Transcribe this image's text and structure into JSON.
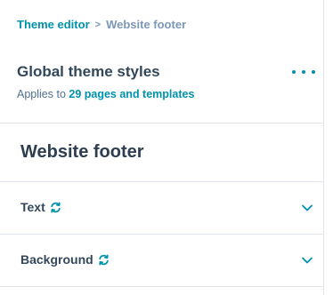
{
  "breadcrumb": {
    "parent": "Theme editor",
    "separator": ">",
    "current": "Website footer"
  },
  "global": {
    "title": "Global theme styles",
    "applies_prefix": "Applies to ",
    "applies_link": "29 pages and templates"
  },
  "section": {
    "title": "Website footer"
  },
  "rows": [
    {
      "label": "Text",
      "icon": "sync-icon"
    },
    {
      "label": "Background",
      "icon": "sync-icon"
    }
  ],
  "colors": {
    "accent": "#0091ae",
    "text": "#33475b",
    "muted": "#7c98b6",
    "divider": "#dfe3eb"
  }
}
